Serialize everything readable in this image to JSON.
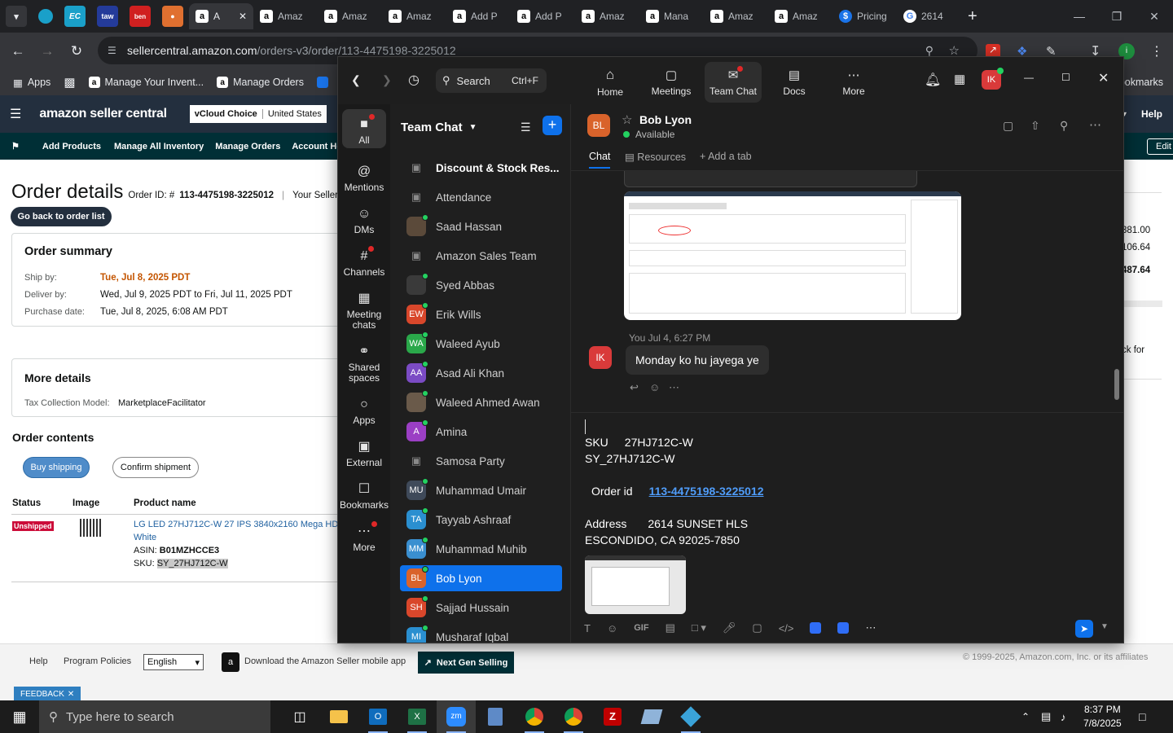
{
  "browser": {
    "tabs": [
      {
        "label": "A"
      },
      {
        "label": "Amaz"
      },
      {
        "label": "Amaz"
      },
      {
        "label": "Amaz"
      },
      {
        "label": "Add P"
      },
      {
        "label": "Add P"
      },
      {
        "label": "Amaz"
      },
      {
        "label": "Mana"
      },
      {
        "label": "Amaz"
      },
      {
        "label": "Amaz"
      },
      {
        "label": "Pricing"
      },
      {
        "label": "2614"
      }
    ],
    "url_host": "sellercentral.amazon.com",
    "url_path": "/orders-v3/order/113-4475198-3225012",
    "bookmarks": [
      "Apps",
      "Manage Your Invent...",
      "Manage Orders"
    ],
    "bookmarks_right": "ookmarks"
  },
  "amazon": {
    "logo": "amazon seller central",
    "choice_badge": "vCloud Choice",
    "choice_region": "United States",
    "help": "Help",
    "nav": [
      "Add Products",
      "Manage All Inventory",
      "Manage Orders",
      "Account Health"
    ],
    "edit": "Edit",
    "page_title": "Order details",
    "order_id_label": "Order ID: #",
    "order_id": "113-4475198-3225012",
    "your_seller": "Your Seller O",
    "back_button": "Go back to order list",
    "summary": {
      "title": "Order summary",
      "ship_by_label": "Ship by:",
      "ship_by": "Tue, Jul 8, 2025 PDT",
      "deliver_by_label": "Deliver by:",
      "deliver_by": "Wed, Jul 9, 2025 PDT to Fri, Jul 11, 2025 PDT",
      "purchase_label": "Purchase date:",
      "purchase": "Tue, Jul 8, 2025, 6:08 AM PDT"
    },
    "more": {
      "title": "More details",
      "tax_label": "Tax Collection Model:",
      "tax": "MarketplaceFacilitator"
    },
    "contents": {
      "title": "Order contents",
      "buy_shipping": "Buy shipping",
      "confirm_shipment": "Confirm shipment",
      "col_status": "Status",
      "col_image": "Image",
      "col_product": "Product name",
      "status": "Unshipped",
      "product": "LG LED 27HJ712C-W 27 IPS 3840x2160 Mega HD",
      "product2": "White",
      "asin_label": "ASIN:",
      "asin": "B01MZHCCE3",
      "sku_label": "SKU:",
      "sku": "SY_27HJ712C-W"
    },
    "right_values": [
      "381.00",
      "106.64",
      "487.64"
    ],
    "right_text": "ck for",
    "footer": {
      "help": "Help",
      "policies": "Program Policies",
      "language": "English",
      "app": "Download the Amazon Seller mobile app",
      "next_gen": "Next Gen Selling",
      "copyright": "© 1999-2025, Amazon.com, Inc. or its affiliates",
      "feedback": "FEEDBACK"
    }
  },
  "zoom": {
    "search": "Search",
    "shortcut": "Ctrl+F",
    "top_tabs": [
      "Home",
      "Meetings",
      "Team Chat",
      "Docs",
      "More"
    ],
    "user_initials": "IK",
    "rail": [
      "All",
      "Mentions",
      "DMs",
      "Channels",
      "Meeting chats",
      "Shared spaces",
      "Apps",
      "External",
      "Bookmarks",
      "More"
    ],
    "list_title": "Team Chat",
    "channels": [
      {
        "name": "Discount & Stock Res...",
        "kind": "lock",
        "bold": true
      },
      {
        "name": "Attendance",
        "kind": "lock"
      },
      {
        "name": "Saad Hassan",
        "kind": "photo",
        "color": "#5b4a3a"
      },
      {
        "name": "Amazon Sales Team",
        "kind": "lock"
      },
      {
        "name": "Syed Abbas",
        "kind": "photo",
        "color": "#3a3a3a"
      },
      {
        "name": "Erik Wills",
        "kind": "initials",
        "initials": "EW",
        "color": "#d9472b"
      },
      {
        "name": "Waleed Ayub",
        "kind": "initials",
        "initials": "WA",
        "color": "#2aa84a"
      },
      {
        "name": "Asad Ali Khan",
        "kind": "initials",
        "initials": "AA",
        "color": "#7b4bc4"
      },
      {
        "name": "Waleed Ahmed Awan",
        "kind": "photo",
        "color": "#6a5a4a"
      },
      {
        "name": "Amina",
        "kind": "initials",
        "initials": "A",
        "color": "#9b3fc4"
      },
      {
        "name": "Samosa Party",
        "kind": "lock"
      },
      {
        "name": "Muhammad Umair",
        "kind": "initials",
        "initials": "MU",
        "color": "#3f4a5a"
      },
      {
        "name": "Tayyab Ashraaf",
        "kind": "initials",
        "initials": "TA",
        "color": "#2a8fd0"
      },
      {
        "name": "Muhammad Muhib",
        "kind": "initials",
        "initials": "MM",
        "color": "#3a8fd0"
      },
      {
        "name": "Bob Lyon",
        "kind": "initials",
        "initials": "BL",
        "color": "#d9632b",
        "selected": true
      },
      {
        "name": "Sajjad Hussain",
        "kind": "initials",
        "initials": "SH",
        "color": "#d9472b"
      },
      {
        "name": "Musharaf Iqbal",
        "kind": "initials",
        "initials": "MI",
        "color": "#2a8fd0"
      }
    ],
    "chat": {
      "contact_initials": "BL",
      "contact_name": "Bob Lyon",
      "status": "Available",
      "tab_chat": "Chat",
      "tab_resources": "Resources",
      "tab_add": "Add a tab",
      "msg_meta": "You Jul 4, 6:27 PM",
      "msg_text": "Monday ko hu jayega ye",
      "my_initials": "IK",
      "compose_sku_label": "SKU",
      "compose_sku": "27HJ712C-W",
      "compose_sku2": "SY_27HJ712C-W",
      "compose_order_label": "Order id",
      "compose_order": "113-4475198-3225012",
      "compose_address_label": "Address",
      "compose_address1": "2614 SUNSET HLS",
      "compose_address2": "ESCONDIDO, CA 92025-7850",
      "gif": "GIF"
    }
  },
  "taskbar": {
    "search": "Type here to search",
    "time": "8:37 PM",
    "date": "7/8/2025"
  }
}
